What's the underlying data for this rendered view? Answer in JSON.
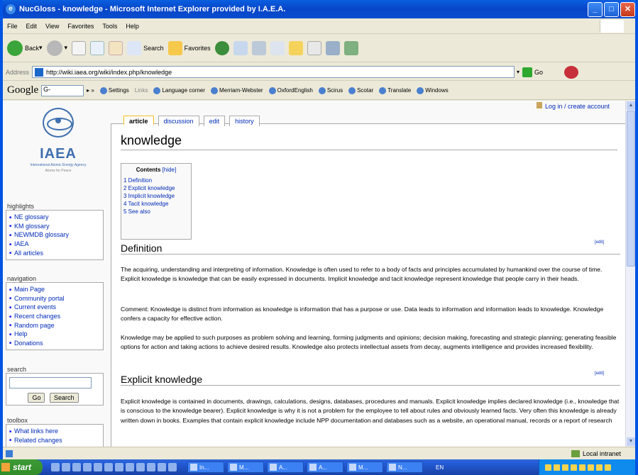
{
  "window": {
    "title": "NucGloss - knowledge - Microsoft Internet Explorer provided by I.A.E.A.",
    "controls": {
      "min": "_",
      "max": "□",
      "close": "✕"
    }
  },
  "menu": [
    "File",
    "Edit",
    "View",
    "Favorites",
    "Tools",
    "Help"
  ],
  "toolbar": {
    "back": "Back",
    "search": "Search",
    "favorites": "Favorites"
  },
  "address": {
    "label": "Address",
    "url": "http://wiki.iaea.org/wiki/index.php/knowledge",
    "go": "Go"
  },
  "googlebar": {
    "logo": "Google",
    "search": "G-",
    "settings": "Settings",
    "links_label": "Links",
    "links": [
      "Language corner",
      "Merriam-Webster",
      "OxfordEnglish",
      "Scirus",
      "Scotar",
      "Translate",
      "Windows"
    ]
  },
  "sidebar": {
    "logo": {
      "text": "IAEA",
      "subtitle": "International Atomic Energy Agency",
      "tagline": "Atoms for Peace"
    },
    "highlights": {
      "title": "highlights",
      "items": [
        "NE glossary",
        "KM glossary",
        "NEWMDB glossary",
        "IAEA",
        "All articles"
      ]
    },
    "navigation": {
      "title": "navigation",
      "items": [
        "Main Page",
        "Community portal",
        "Current events",
        "Recent changes",
        "Random page",
        "Help",
        "Donations"
      ]
    },
    "search": {
      "title": "search",
      "go": "Go",
      "search": "Search"
    },
    "toolbox": {
      "title": "toolbox",
      "items": [
        "What links here",
        "Related changes"
      ]
    }
  },
  "user": {
    "link": "Log in / create account"
  },
  "tabs": [
    "article",
    "discussion",
    "edit",
    "history"
  ],
  "page": {
    "title": "knowledge",
    "toc": {
      "title": "Contents",
      "hide": "[hide]",
      "items": [
        "1 Definition",
        "2 Explicit knowledge",
        "3 Implicit knowledge",
        "4 Tacit knowledge",
        "5 See also"
      ]
    },
    "edit_label": "[edit]",
    "sections": [
      {
        "heading": "Definition",
        "paragraphs": [
          "The acquiring, understanding and interpreting of information. Knowledge is often used to refer to a body of facts and principles accumulated by humankind over the course of time. Explicit knowledge is knowledge that can be easily expressed in documents. Implicit knowledge and tacit knowledge represent knowledge that people carry in their heads.",
          "Comment: Knowledge is distinct from information as knowledge is information that has a purpose or use. Data leads to information and information leads to knowledge. Knowledge confers a capacity for effective action.",
          "Knowledge may be applied to such purposes as problem solving and learning, forming judgments and opinions; decision making, forecasting and strategic planning; generating feasible options for action and taking actions to achieve desired results. Knowledge also protects intellectual assets from decay, augments intelligence and provides increased flexibility."
        ]
      },
      {
        "heading": "Explicit knowledge",
        "paragraphs": [
          "Explicit knowledge is contained in documents, drawings, calculations, designs, databases, procedures and manuals. Explicit knowledge implies declared knowledge (i.e., knowledge that is conscious to the knowledge bearer). Explicit knowledge is why it is not a problem for the employee to tell about rules and obviously learned facts. Very often this knowledge is already written down in books. Examples that contain explicit knowledge include NPP documentation and databases such as a website, an operational manual, records or a report of research"
        ]
      }
    ]
  },
  "status": {
    "zone": "Local intranet"
  },
  "taskbar": {
    "start": "start",
    "tasks": [
      "In...",
      "M...",
      "A...",
      "A...",
      "M...",
      "N..."
    ],
    "lang": "EN"
  }
}
